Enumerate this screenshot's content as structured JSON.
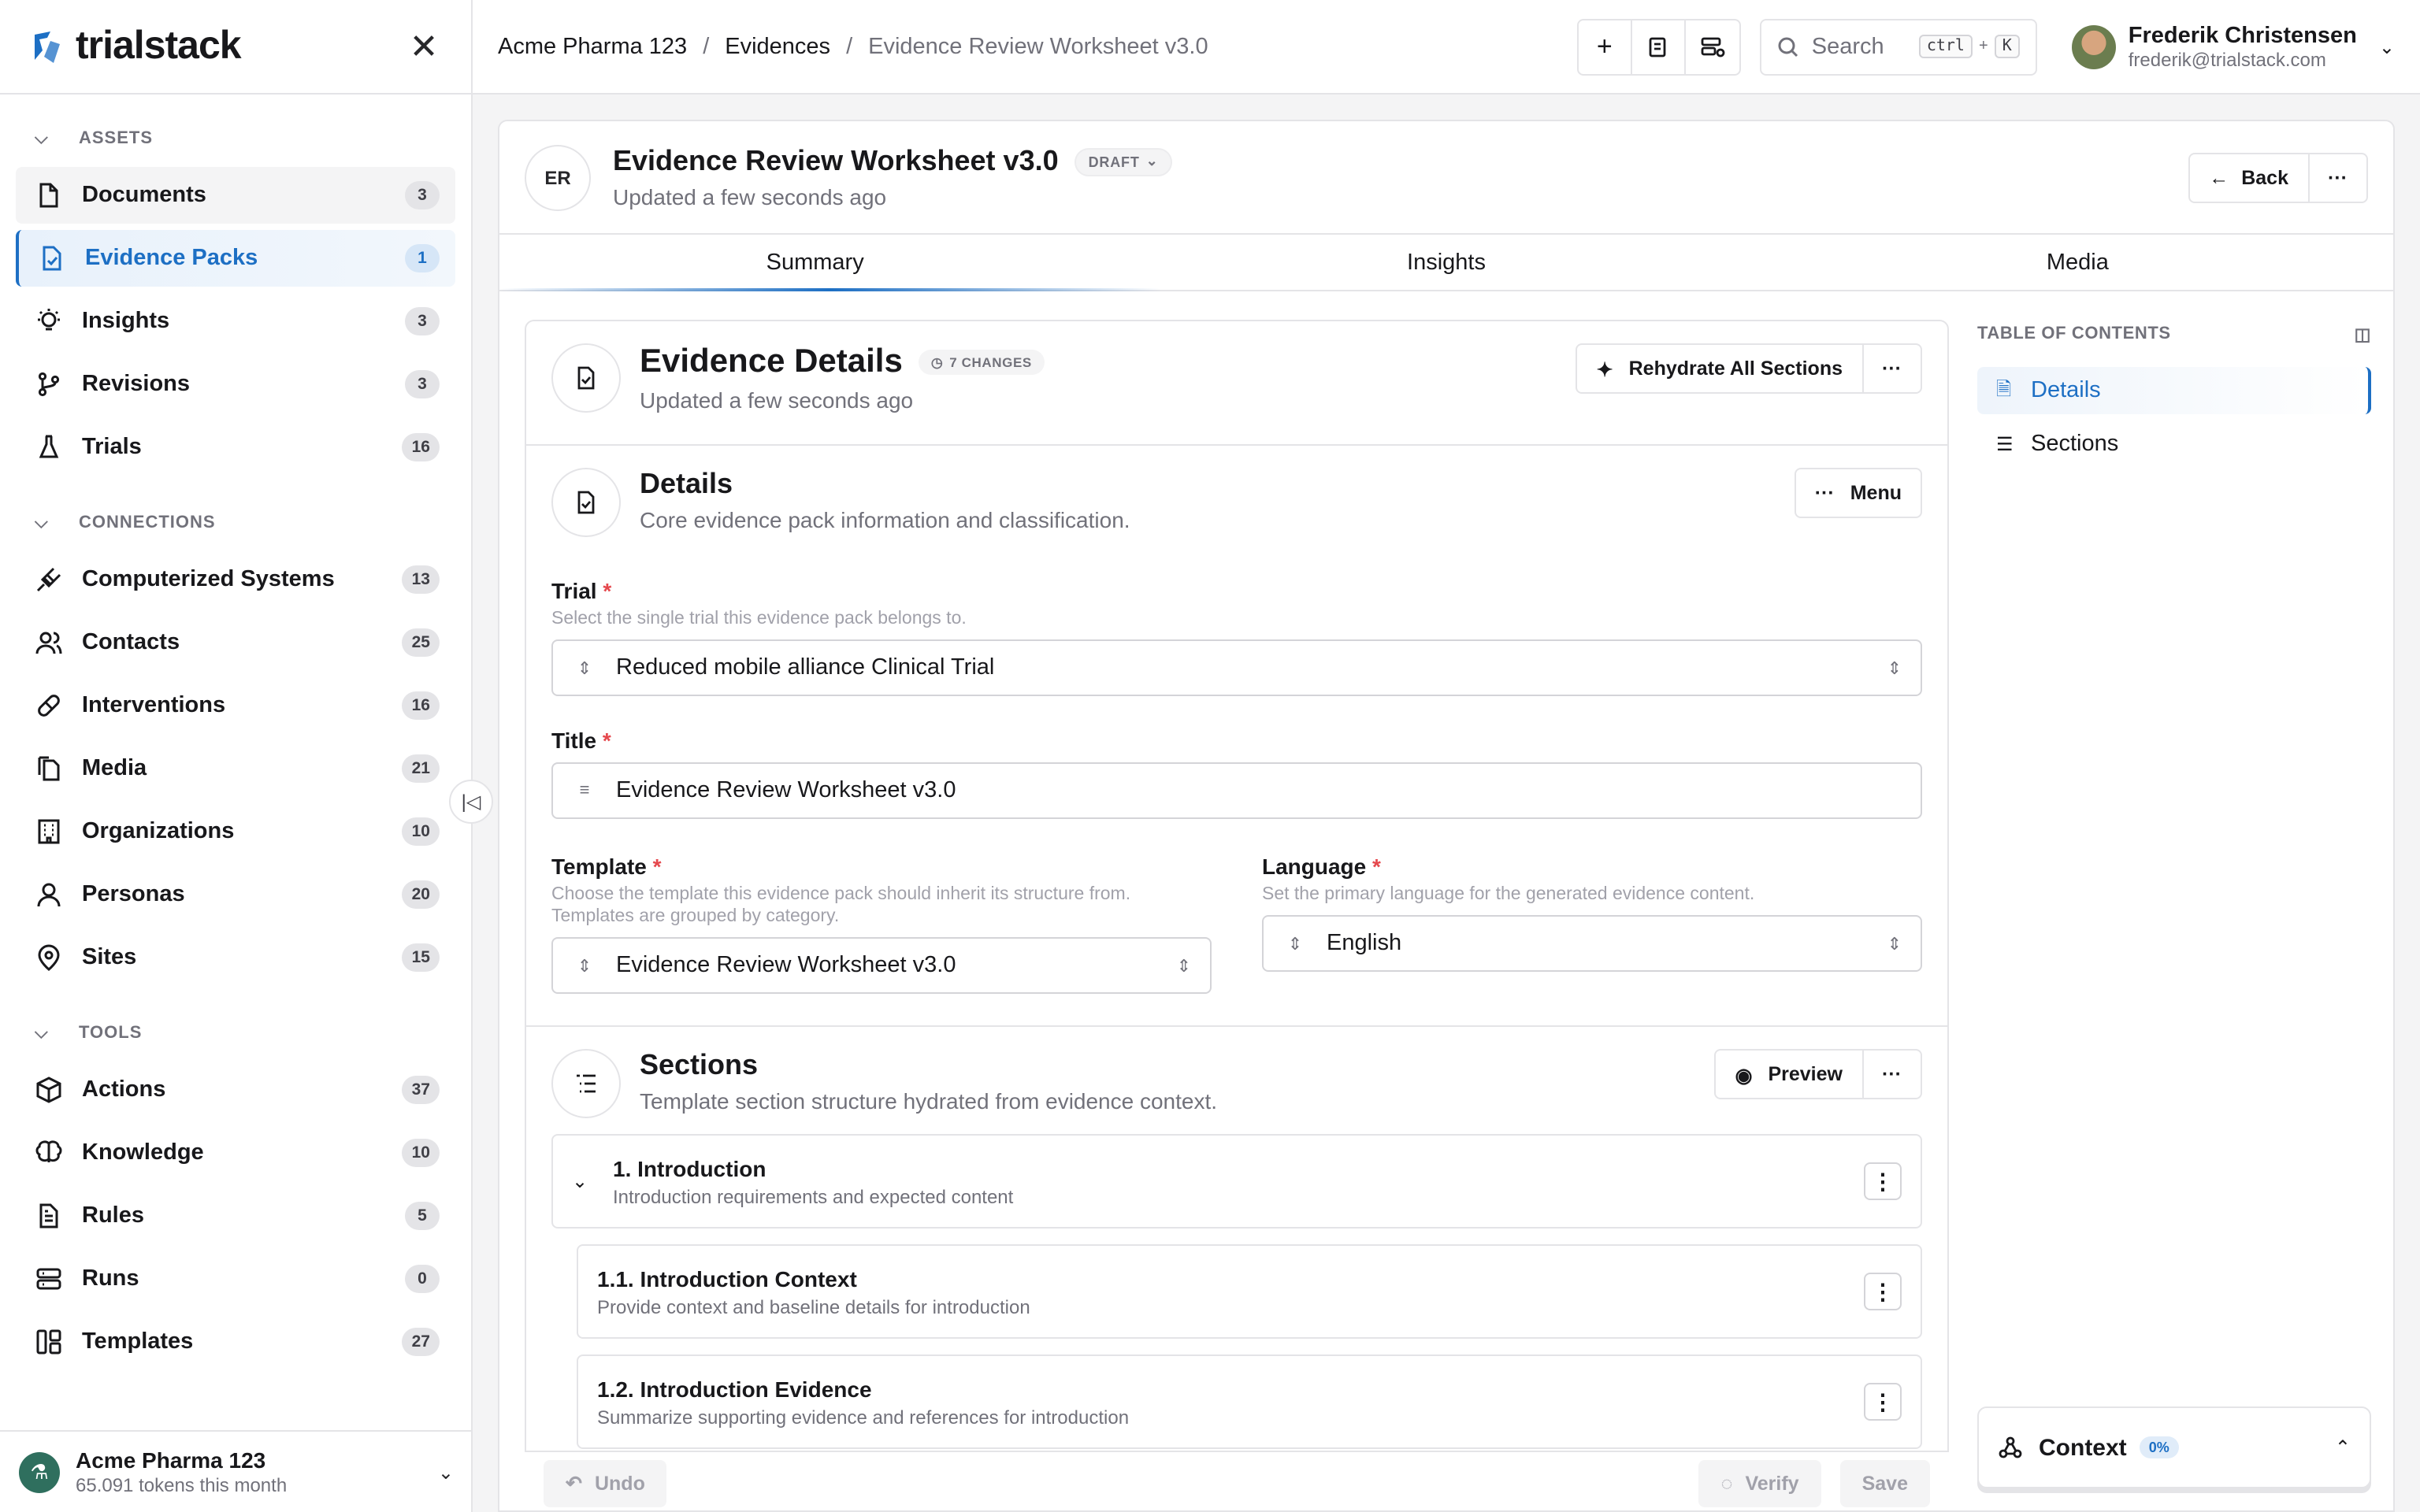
{
  "brand": {
    "name": "trialstack",
    "accent": "#1d6fc4"
  },
  "sidebar": {
    "groups": [
      {
        "label": "ASSETS",
        "items": [
          {
            "label": "Documents",
            "count": "3",
            "icon": "document-icon"
          },
          {
            "label": "Evidence Packs",
            "count": "1",
            "icon": "evidence-pack-icon"
          },
          {
            "label": "Insights",
            "count": "3",
            "icon": "lightbulb-icon"
          },
          {
            "label": "Revisions",
            "count": "3",
            "icon": "git-branch-icon"
          },
          {
            "label": "Trials",
            "count": "16",
            "icon": "flask-icon"
          }
        ]
      },
      {
        "label": "CONNECTIONS",
        "items": [
          {
            "label": "Computerized Systems",
            "count": "13",
            "icon": "plug-icon"
          },
          {
            "label": "Contacts",
            "count": "25",
            "icon": "users-icon"
          },
          {
            "label": "Interventions",
            "count": "16",
            "icon": "pill-icon"
          },
          {
            "label": "Media",
            "count": "21",
            "icon": "media-icon"
          },
          {
            "label": "Organizations",
            "count": "10",
            "icon": "building-icon"
          },
          {
            "label": "Personas",
            "count": "20",
            "icon": "person-icon"
          },
          {
            "label": "Sites",
            "count": "15",
            "icon": "map-pin-icon"
          }
        ]
      },
      {
        "label": "TOOLS",
        "items": [
          {
            "label": "Actions",
            "count": "37",
            "icon": "box-icon"
          },
          {
            "label": "Knowledge",
            "count": "10",
            "icon": "brain-icon"
          },
          {
            "label": "Rules",
            "count": "5",
            "icon": "rules-icon"
          },
          {
            "label": "Runs",
            "count": "0",
            "icon": "server-icon"
          },
          {
            "label": "Templates",
            "count": "27",
            "icon": "template-icon"
          }
        ]
      }
    ],
    "org": {
      "name": "Acme Pharma 123",
      "usage": "65.091 tokens this month"
    }
  },
  "topbar": {
    "breadcrumbs": [
      "Acme Pharma 123",
      "Evidences",
      "Evidence Review Worksheet v3.0"
    ],
    "search_placeholder": "Search",
    "kbd_ctrl": "ctrl",
    "kbd_plus": "+",
    "kbd_k": "K",
    "user": {
      "name": "Frederik Christensen",
      "email": "frederik@trialstack.com"
    }
  },
  "doc": {
    "initials": "ER",
    "title": "Evidence Review Worksheet v3.0",
    "status": "DRAFT",
    "updated": "Updated a few seconds ago",
    "back_label": "Back",
    "tabs": [
      "Summary",
      "Insights",
      "Media"
    ]
  },
  "evidence": {
    "title": "Evidence Details",
    "changes": "7 CHANGES",
    "updated": "Updated a few seconds ago",
    "rehydrate_label": "Rehydrate All Sections"
  },
  "details": {
    "title": "Details",
    "subtitle": "Core evidence pack information and classification.",
    "menu_label": "Menu",
    "trial": {
      "label": "Trial",
      "help": "Select the single trial this evidence pack belongs to.",
      "value": "Reduced mobile alliance Clinical Trial"
    },
    "title_field": {
      "label": "Title",
      "value": "Evidence Review Worksheet v3.0"
    },
    "template": {
      "label": "Template",
      "help": "Choose the template this evidence pack should inherit its structure from. Templates are grouped by category.",
      "value": "Evidence Review Worksheet v3.0"
    },
    "language": {
      "label": "Language",
      "help": "Set the primary language for the generated evidence content.",
      "value": "English"
    }
  },
  "sections": {
    "title": "Sections",
    "subtitle": "Template section structure hydrated from evidence context.",
    "preview_label": "Preview",
    "items": [
      {
        "title": "1. Introduction",
        "desc": "Introduction requirements and expected content"
      },
      {
        "title": "1.1. Introduction Context",
        "desc": "Provide context and baseline details for introduction"
      },
      {
        "title": "1.2. Introduction Evidence",
        "desc": "Summarize supporting evidence and references for introduction"
      }
    ]
  },
  "footer": {
    "undo": "Undo",
    "verify": "Verify",
    "save": "Save"
  },
  "toc": {
    "heading": "TABLE OF CONTENTS",
    "items": [
      "Details",
      "Sections"
    ]
  },
  "context": {
    "label": "Context",
    "percent": "0%"
  }
}
